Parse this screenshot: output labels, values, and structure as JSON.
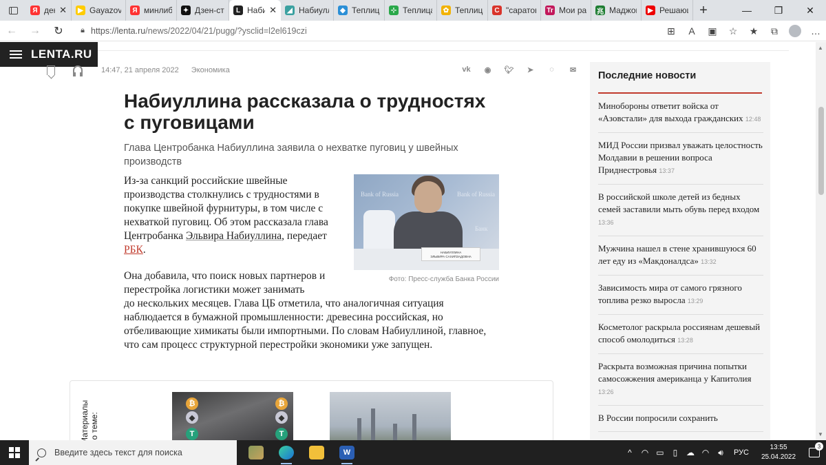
{
  "browser": {
    "tabs": [
      {
        "title": "ден",
        "fav_color": "#f33",
        "fav_glyph": "Я",
        "active": false
      },
      {
        "title": "Gayazov",
        "fav_color": "#ffcc00",
        "fav_glyph": "▶",
        "active": false
      },
      {
        "title": "минлибе",
        "fav_color": "#f33",
        "fav_glyph": "Я",
        "active": false
      },
      {
        "title": "Дзен-сту",
        "fav_color": "#111",
        "fav_glyph": "✦",
        "active": false
      },
      {
        "title": "Наби",
        "fav_color": "#222",
        "fav_glyph": "L",
        "active": true
      },
      {
        "title": "Набиулл",
        "fav_color": "#3aa0a0",
        "fav_glyph": "◢",
        "active": false
      },
      {
        "title": "Теплица",
        "fav_color": "#2b8fd6",
        "fav_glyph": "◆",
        "active": false
      },
      {
        "title": "Теплица",
        "fav_color": "#2aa84a",
        "fav_glyph": "⊹",
        "active": false
      },
      {
        "title": "Теплица",
        "fav_color": "#f2b200",
        "fav_glyph": "✿",
        "active": false
      },
      {
        "title": "\"саратов",
        "fav_color": "#d9342b",
        "fav_glyph": "C",
        "active": false
      },
      {
        "title": "Мои раб",
        "fav_color": "#c2185b",
        "fav_glyph": "Tr",
        "active": false
      },
      {
        "title": "Маджон",
        "fav_color": "#1e7d32",
        "fav_glyph": "兆",
        "active": false
      },
      {
        "title": "Решаюш",
        "fav_color": "#e00",
        "fav_glyph": "▶",
        "active": false
      }
    ],
    "url_host": "https://lenta.ru",
    "url_path": "/news/2022/04/21/pugg/?ysclid=l2el619czi"
  },
  "site": {
    "logo": "LENTA.RU"
  },
  "article": {
    "timestamp": "14:47, 21 апреля 2022",
    "rubric": "Экономика",
    "headline": "Набиуллина рассказала о трудностях с пуговицами",
    "lede": "Глава Центробанка Набиуллина заявила о нехватке пуговиц у швейных производств",
    "p1_text": "Из-за санкций российские швейные производства столкнулись с трудностями в покупке швейной фурнитуры, в том числе с нехваткой пуговиц. Об этом рассказала глава Центробанка ",
    "p1_link": "Эльвира Набиуллина",
    "p1_mid": ", передает ",
    "p1_source": "РБК",
    "p1_end": ".",
    "p2_a": "Она добавила, что поиск новых партнеров и перестройка логистики может занимать",
    "p2_b": "до нескольких месяцев. Глава ЦБ отметила, что аналогичная ситуация наблюдается в бумажной промышленности: древесина российская, но отбеливающие химикаты были импортными. По словам Набиуллиной, главное, что сам процесс структурной перестройки экономики уже запущен.",
    "photo_caption": "Фото: Пресс-служба Банка России",
    "photo_bank_label": "Bank of Russia",
    "photo_bank_label2": "Банк",
    "photo_plate": "НАБИУЛЛИНА\nЭЛЬВИРА САХИПЗАДОВНА",
    "related_label": "Материалы по теме:"
  },
  "share_icons": [
    "vk-icon",
    "ok-icon",
    "twitter-icon",
    "telegram-icon",
    "whatsapp-icon",
    "mail-icon"
  ],
  "sidebar": {
    "title": "Последние новости",
    "items": [
      {
        "text": "Минобороны ответит войска от «Азовстали» для выхода гражданских",
        "time": "12:48"
      },
      {
        "text": "МИД России призвал уважать целостность Молдавии в решении вопроса Приднестровья",
        "time": "13:37"
      },
      {
        "text": "В российской школе детей из бедных семей заставили мыть обувь перед входом",
        "time": "13:36"
      },
      {
        "text": "Мужчина нашел в стене хранившуюся 60 лет еду из «Макдоналдса»",
        "time": "13:32"
      },
      {
        "text": "Зависимость мира от самого грязного топлива резко выросла",
        "time": "13:29"
      },
      {
        "text": "Косметолог раскрыла россиянам дешевый способ омолодиться",
        "time": "13:28"
      },
      {
        "text": "Раскрыта возможная причина попытки самосожжения американца у Капитолия",
        "time": "13:26"
      },
      {
        "text": "В России попросили сохранить",
        "time": ""
      }
    ]
  },
  "taskbar": {
    "search_placeholder": "Введите здесь текст для поиска",
    "lang": "РУС",
    "time": "13:55",
    "date": "25.04.2022",
    "notifications": "3"
  },
  "colors": {
    "accent_red": "#c0392b",
    "logo_bg": "#222222",
    "taskbar_bg": "#202020"
  }
}
